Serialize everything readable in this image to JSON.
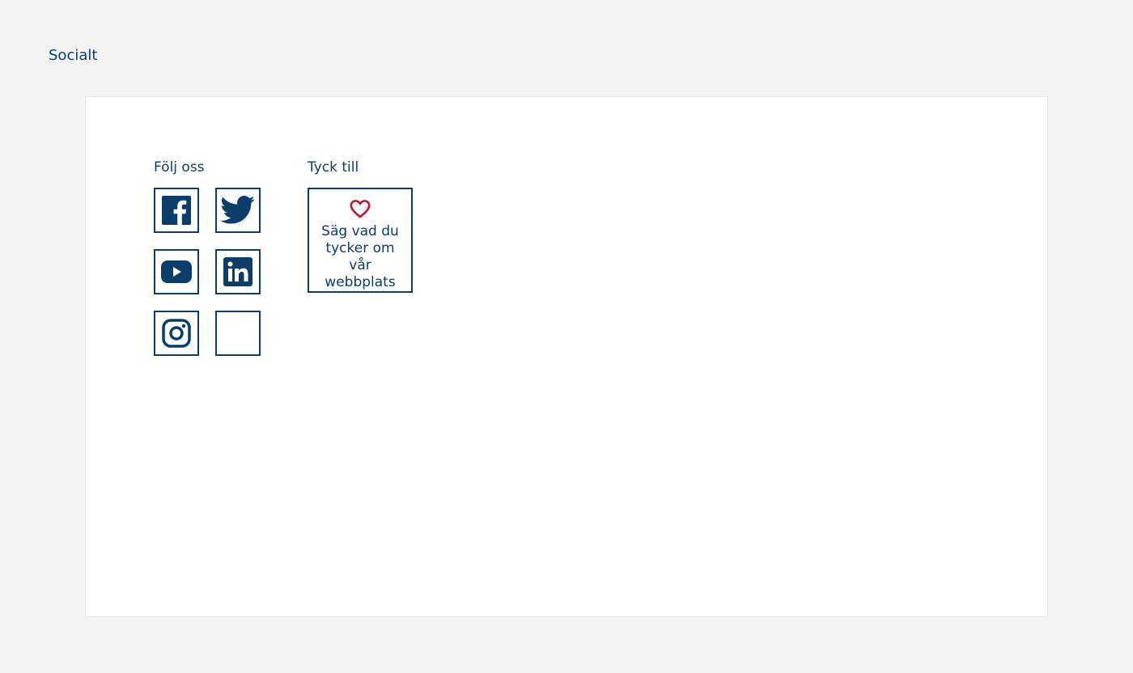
{
  "page": {
    "heading": "Socialt"
  },
  "follow": {
    "title": "Följ oss",
    "links": [
      {
        "icon": "facebook-icon"
      },
      {
        "icon": "twitter-icon"
      },
      {
        "icon": "youtube-icon"
      },
      {
        "icon": "linkedin-icon"
      },
      {
        "icon": "instagram-icon"
      },
      {
        "icon": ""
      }
    ]
  },
  "feedback": {
    "title": "Tyck till",
    "icon": "heart-icon",
    "text": "Säg vad du tycker om vår webbplats"
  },
  "colors": {
    "primary": "#0b3d6b",
    "accent": "#c8102e",
    "background": "#f3f3f3",
    "panel": "#ffffff"
  }
}
